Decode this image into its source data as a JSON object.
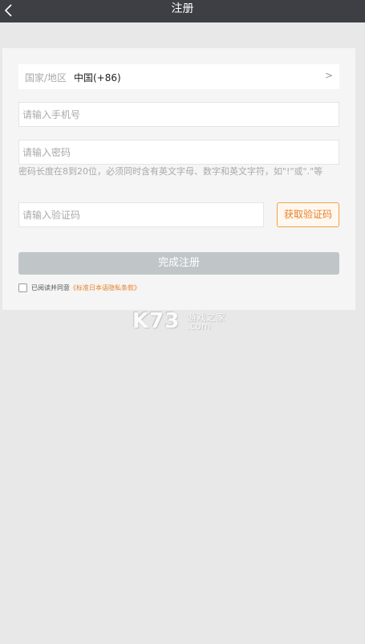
{
  "header": {
    "title": "注册",
    "back_icon": "chevron-left-icon"
  },
  "form": {
    "country_label": "国家/地区",
    "country_value": "中国(+86)",
    "country_arrow": ">",
    "phone_placeholder": "请输入手机号",
    "password_placeholder": "请输入密码",
    "password_hint": "密码长度在8到20位，必须同时含有英文字母、数字和英文字符，如\"!\"或\".\"等",
    "code_placeholder": "请输入验证码",
    "get_code_label": "获取验证码",
    "submit_label": "完成注册",
    "agree_prefix": "已阅读并同意",
    "agree_link": "《标准日本语隐私条款》"
  },
  "watermark": {
    "brand": "K73",
    "cn": "游戏之家",
    "domain": ".com"
  },
  "colors": {
    "nav_bg": "#3e3f45",
    "accent": "#e8802a",
    "submit_disabled": "#c0c6c8",
    "page_bg": "#e8e8e8"
  }
}
